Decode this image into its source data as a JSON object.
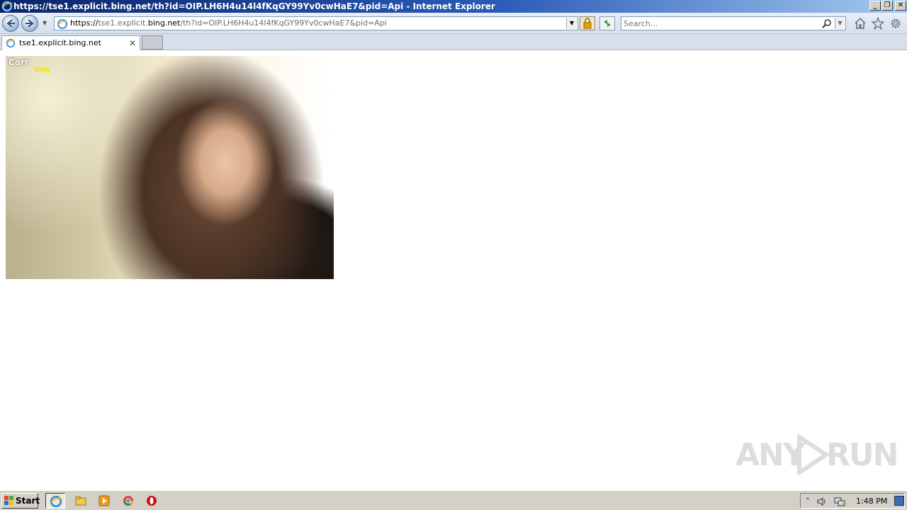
{
  "window": {
    "title": "https://tse1.explicit.bing.net/th?id=OIP.LH6H4u14l4fKqGY99Yv0cwHaE7&pid=Api - Internet Explorer",
    "min_label": "_",
    "max_label": "❐",
    "close_label": "✕"
  },
  "address": {
    "scheme": "https://",
    "host_prefix": "tse1.explicit.",
    "host_domain": "bing.net",
    "path": "/th?id=OIP.LH6H4u14l4fKqGY99Yv0cwHaE7&pid=Api"
  },
  "search": {
    "placeholder": "Search..."
  },
  "tabs": [
    {
      "label": "tse1.explicit.bing.net",
      "close": "✕"
    }
  ],
  "content": {
    "image_watermark_main": "Carr     ",
    "image_watermark_sub": "Blog"
  },
  "watermark": {
    "left_text": "ANY",
    "right_text": "RUN"
  },
  "taskbar": {
    "start_label": "Start",
    "tray_arrow": "˄",
    "clock": "1:48 PM"
  },
  "colors": {
    "titlebar_start": "#0a246a",
    "titlebar_end": "#a6caf0",
    "taskbar": "#d4d0c8"
  },
  "icons": [
    "ie-icon",
    "back-icon",
    "forward-icon",
    "page-icon",
    "lock-icon",
    "refresh-icon",
    "search-icon",
    "home-icon",
    "star-icon",
    "gear-icon",
    "windows-flag-icon",
    "folder-icon",
    "media-player-icon",
    "chrome-icon",
    "opera-icon",
    "volume-icon",
    "network-icon"
  ]
}
